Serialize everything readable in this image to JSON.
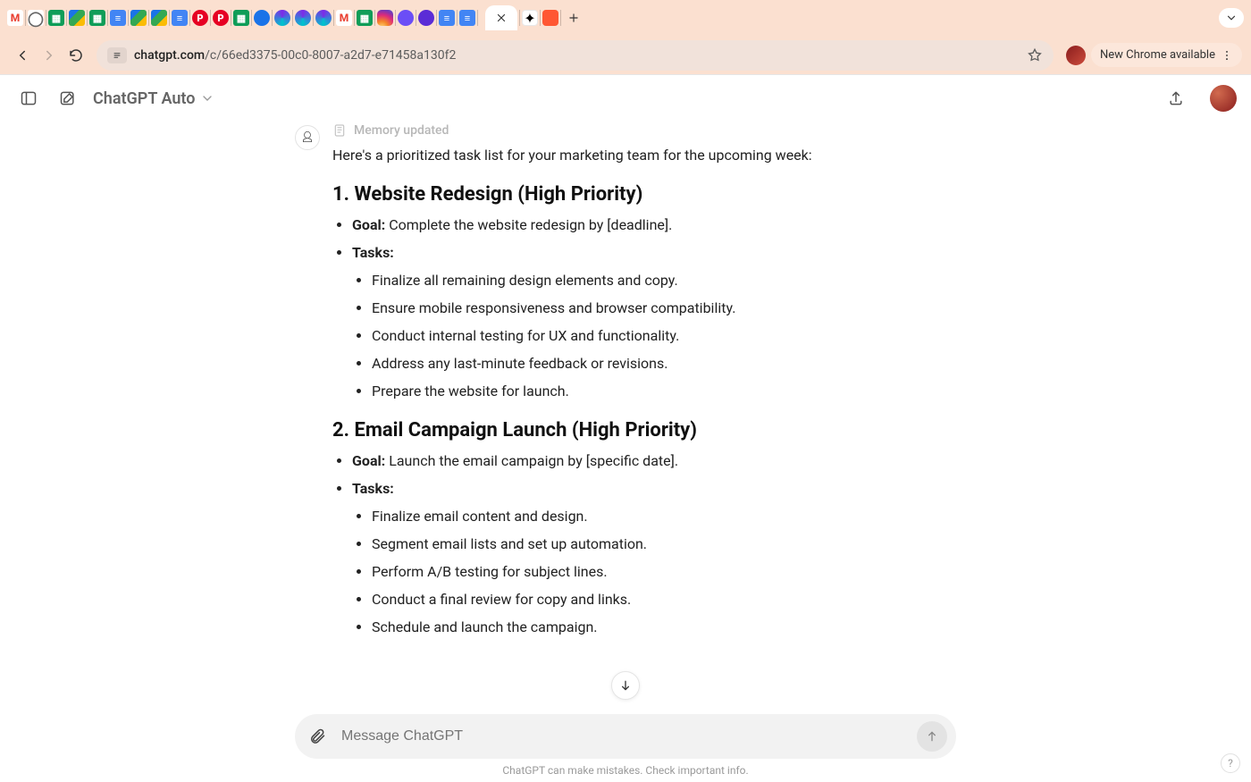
{
  "browser": {
    "url_domain": "chatgpt.com",
    "url_path": "/c/66ed3375-00c0-8007-a2d7-e71458a130f2",
    "new_chrome_pill": "New Chrome available",
    "tabs": [
      {
        "name": "gmail-icon"
      },
      {
        "name": "globe-icon"
      },
      {
        "name": "sheets-icon"
      },
      {
        "name": "drive-icon"
      },
      {
        "name": "sheets-icon"
      },
      {
        "name": "docs-icon"
      },
      {
        "name": "drive-icon"
      },
      {
        "name": "drive-icon"
      },
      {
        "name": "docs-icon"
      },
      {
        "name": "pinterest-icon"
      },
      {
        "name": "pinterest-icon"
      },
      {
        "name": "sheets-icon"
      },
      {
        "name": "meet-icon"
      },
      {
        "name": "canva-icon"
      },
      {
        "name": "canva-icon"
      },
      {
        "name": "canva-icon"
      },
      {
        "name": "gmail-icon"
      },
      {
        "name": "sheets-icon"
      },
      {
        "name": "instagram-icon"
      },
      {
        "name": "purple-app-icon"
      },
      {
        "name": "purple-app-icon"
      },
      {
        "name": "docs-icon"
      },
      {
        "name": "docs-icon"
      }
    ]
  },
  "app": {
    "model_label": "ChatGPT Auto",
    "memory_note": "Memory updated",
    "composer_placeholder": "Message ChatGPT",
    "disclaimer": "ChatGPT can make mistakes. Check important info.",
    "help_label": "?"
  },
  "message": {
    "intro": "Here's a prioritized task list for your marketing team for the upcoming week:",
    "sections": [
      {
        "heading": "1. Website Redesign (High Priority)",
        "goal_label": "Goal:",
        "goal_text": " Complete the website redesign by [deadline].",
        "tasks_label": "Tasks:",
        "tasks": [
          "Finalize all remaining design elements and copy.",
          "Ensure mobile responsiveness and browser compatibility.",
          "Conduct internal testing for UX and functionality.",
          "Address any last-minute feedback or revisions.",
          "Prepare the website for launch."
        ]
      },
      {
        "heading": "2. Email Campaign Launch (High Priority)",
        "goal_label": "Goal:",
        "goal_text": " Launch the email campaign by [specific date].",
        "tasks_label": "Tasks:",
        "tasks": [
          "Finalize email content and design.",
          "Segment email lists and set up automation.",
          "Perform A/B testing for subject lines.",
          "Conduct a final review for copy and links.",
          "Schedule and launch the campaign."
        ]
      }
    ]
  }
}
